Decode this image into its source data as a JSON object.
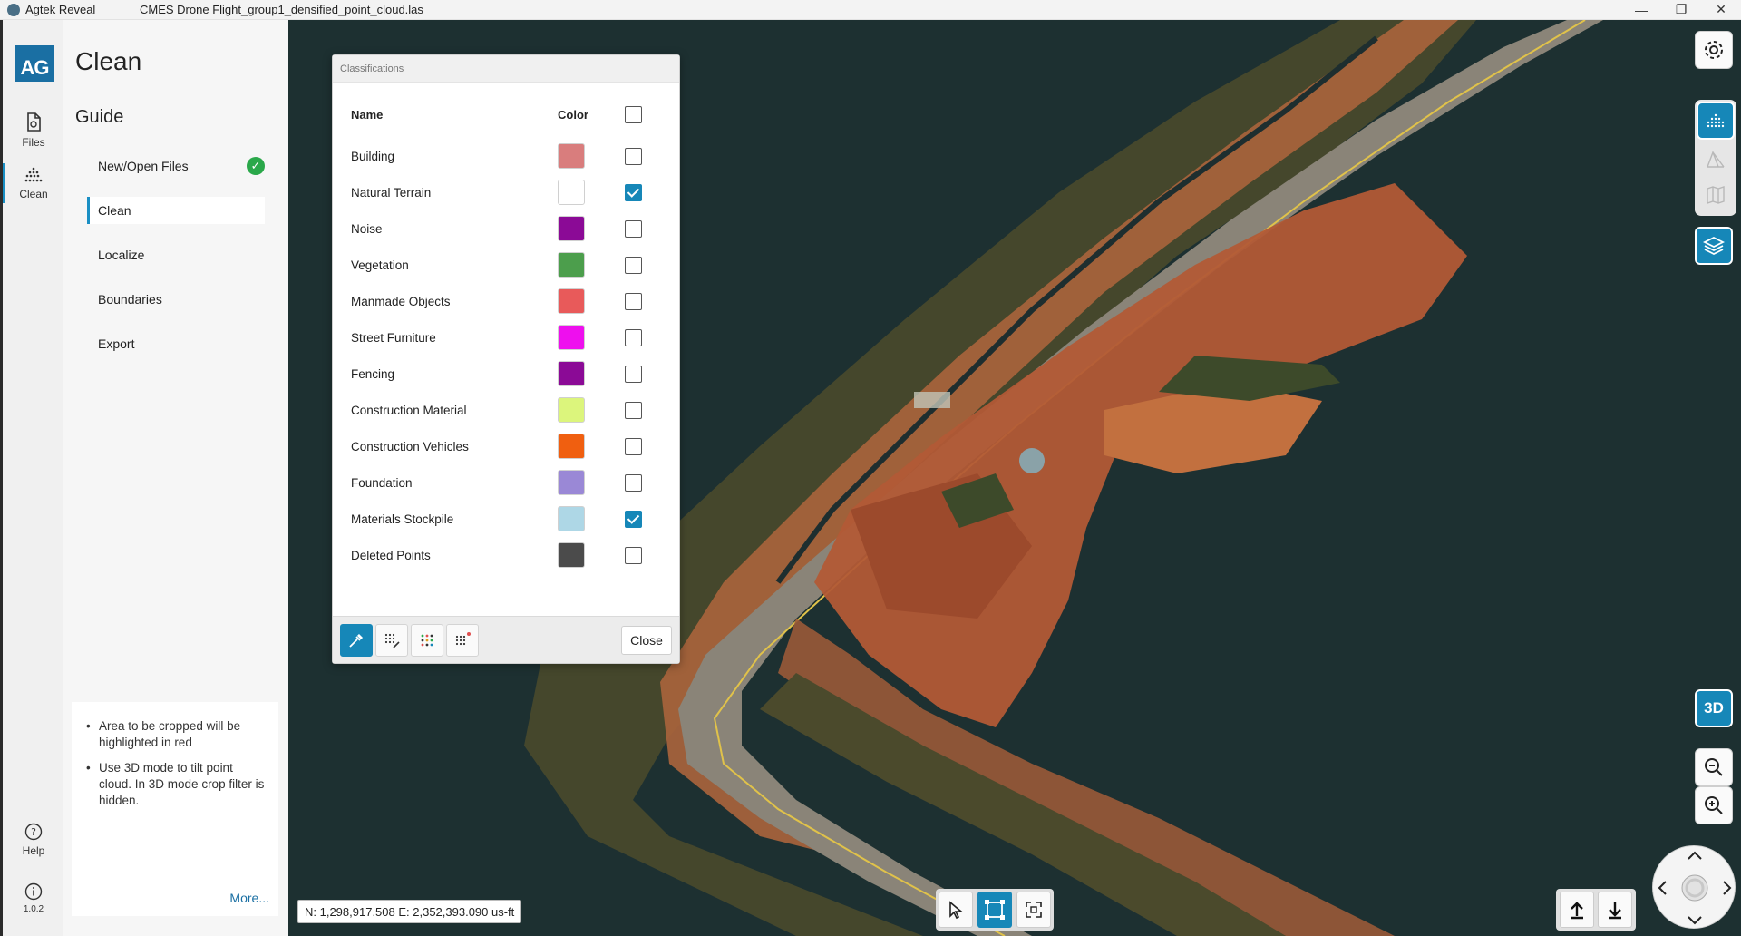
{
  "titlebar": {
    "app_name": "Agtek Reveal",
    "file_name": "CMES Drone Flight_group1_densified_point_cloud.las"
  },
  "rail": {
    "logo": "AG",
    "files_label": "Files",
    "clean_label": "Clean",
    "help_label": "Help",
    "version": "1.0.2"
  },
  "guide": {
    "title": "Clean",
    "subtitle": "Guide",
    "steps": [
      {
        "label": "New/Open Files",
        "done": true
      },
      {
        "label": "Clean",
        "active": true
      },
      {
        "label": "Localize"
      },
      {
        "label": "Boundaries"
      },
      {
        "label": "Export"
      }
    ],
    "tips": [
      "Area to be cropped will be highlighted in red",
      "Use 3D mode to tilt point cloud. In 3D mode crop filter is hidden."
    ],
    "more_link": "More..."
  },
  "classifications": {
    "title": "Classifications",
    "col_name": "Name",
    "col_color": "Color",
    "header_checked": false,
    "rows": [
      {
        "name": "Building",
        "color": "#d97d7d",
        "checked": false
      },
      {
        "name": "Natural Terrain",
        "color": "#ffffff",
        "checked": true
      },
      {
        "name": "Noise",
        "color": "#8b0a96",
        "checked": false
      },
      {
        "name": "Vegetation",
        "color": "#4c9e4c",
        "checked": false
      },
      {
        "name": "Manmade Objects",
        "color": "#e85a5a",
        "checked": false
      },
      {
        "name": "Street Furniture",
        "color": "#ee0fee",
        "checked": false
      },
      {
        "name": "Fencing",
        "color": "#8b0a96",
        "checked": false
      },
      {
        "name": "Construction Material",
        "color": "#dcf57c",
        "checked": false
      },
      {
        "name": "Construction Vehicles",
        "color": "#f05f10",
        "checked": false
      },
      {
        "name": "Foundation",
        "color": "#9a88d6",
        "checked": false
      },
      {
        "name": "Materials Stockpile",
        "color": "#aed7e6",
        "checked": true
      },
      {
        "name": "Deleted Points",
        "color": "#4b4b4b",
        "checked": false
      }
    ],
    "close_label": "Close"
  },
  "view": {
    "mode_label": "3D",
    "coordinates": "N: 1,298,917.508 E: 2,352,393.090 us-ft"
  },
  "colors": {
    "accent": "#1687b8",
    "brand": "#1a6fa3",
    "success": "#2aa84a"
  }
}
